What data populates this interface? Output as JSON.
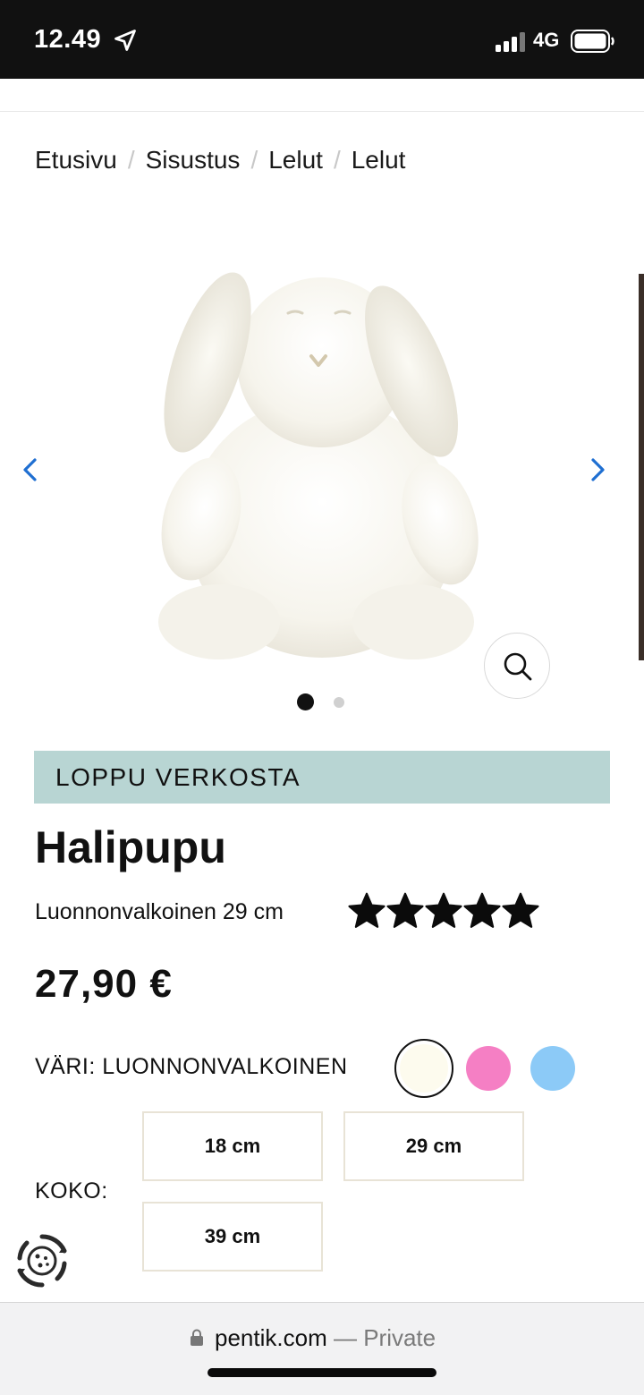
{
  "status_bar": {
    "time": "12.49",
    "network": "4G",
    "location_icon": "location-arrow-icon",
    "signal_icon": "signal-bars-icon",
    "battery_icon": "battery-icon"
  },
  "breadcrumb": {
    "items": [
      "Etusivu",
      "Sisustus",
      "Lelut",
      "Lelut"
    ],
    "separator": "/"
  },
  "carousel": {
    "image_subject": "white plush bunny",
    "prev_icon": "chevron-left-icon",
    "next_icon": "chevron-right-icon",
    "zoom_icon": "magnifier-icon",
    "slide_count": 2,
    "active_slide": 1
  },
  "product": {
    "availability": "LOPPU VERKOSTA",
    "name": "Halipupu",
    "variant": "Luonnonvalkoinen 29 cm",
    "rating": 5,
    "rating_max": 5,
    "price": "27,90 €"
  },
  "color": {
    "label": "VÄRI: LUONNONVALKOINEN",
    "swatches": [
      {
        "name": "luonnonvalkoinen",
        "hex": "#fdfbee",
        "selected": true
      },
      {
        "name": "pink",
        "hex": "#f57fc4",
        "selected": false
      },
      {
        "name": "blue",
        "hex": "#8ccaf7",
        "selected": false
      }
    ]
  },
  "size": {
    "label": "KOKO:",
    "options": [
      "18 cm",
      "29 cm",
      "39 cm"
    ]
  },
  "cookie_icon": "cookie-settings-icon",
  "browser": {
    "host": "pentik.com",
    "privacy": "— Private",
    "lock_icon": "lock-icon"
  },
  "colors": {
    "banner": "#b8d5d3",
    "arrow_blue": "#1f6fd1",
    "status_bar": "#111111"
  }
}
